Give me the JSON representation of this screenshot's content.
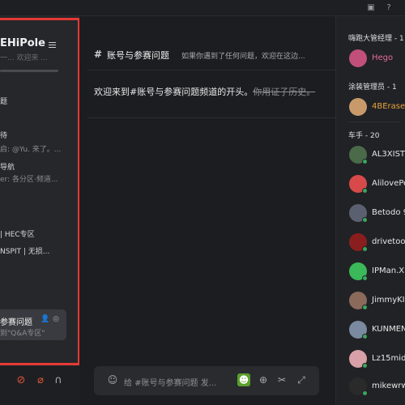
{
  "server": {
    "name": "EHiPole",
    "header_subtext": "一... 欢迎来 ..."
  },
  "channels": [
    {
      "name": "题",
      "preview": ""
    },
    {
      "name": "待",
      "preview": "启: @Yu. 来了。..."
    },
    {
      "name": "导航",
      "preview": "er: 各分区·频道..."
    },
    {
      "name": "| HEC专区",
      "preview": ""
    },
    {
      "name": "NSPIT | 无损...",
      "preview": ""
    }
  ],
  "active_channel": {
    "name": "参赛问题",
    "preview": "到\"Q&A专区\""
  },
  "channel_header": {
    "hash": "#",
    "title": "账号与参赛问题",
    "topic": "如果你遇到了任何问题，欢迎在这边..."
  },
  "welcome": {
    "text": "欢迎来到#账号与参赛问题频道的开头。",
    "struck": "你用证子历史。"
  },
  "composer": {
    "placeholder": "给 #账号与参赛问题 发..."
  },
  "member_groups": [
    {
      "label": "嗨跑大管经理 - 1",
      "members": [
        {
          "name": "Hego",
          "color": "#e56b9a"
        }
      ]
    },
    {
      "label": "涂装管理员 - 1",
      "members": [
        {
          "name": "4BEraser",
          "color": "#e6a23c"
        }
      ]
    },
    {
      "label": "车手 - 20",
      "members": [
        {
          "name": "AL3XISTI",
          "color": "#e6e6e6"
        },
        {
          "name": "AlilovePe",
          "color": "#e6e6e6"
        },
        {
          "name": "Betodo 9",
          "color": "#e6e6e6"
        },
        {
          "name": "drivetoo",
          "color": "#e6e6e6"
        },
        {
          "name": "IPMan.X",
          "color": "#e6e6e6"
        },
        {
          "name": "JimmyKI",
          "color": "#e6e6e6"
        },
        {
          "name": "KUNMEN",
          "color": "#e6e6e6"
        },
        {
          "name": "Lz15mid",
          "color": "#e6e6e6"
        },
        {
          "name": "mikewrw",
          "color": "#e6e6e6"
        }
      ]
    }
  ]
}
